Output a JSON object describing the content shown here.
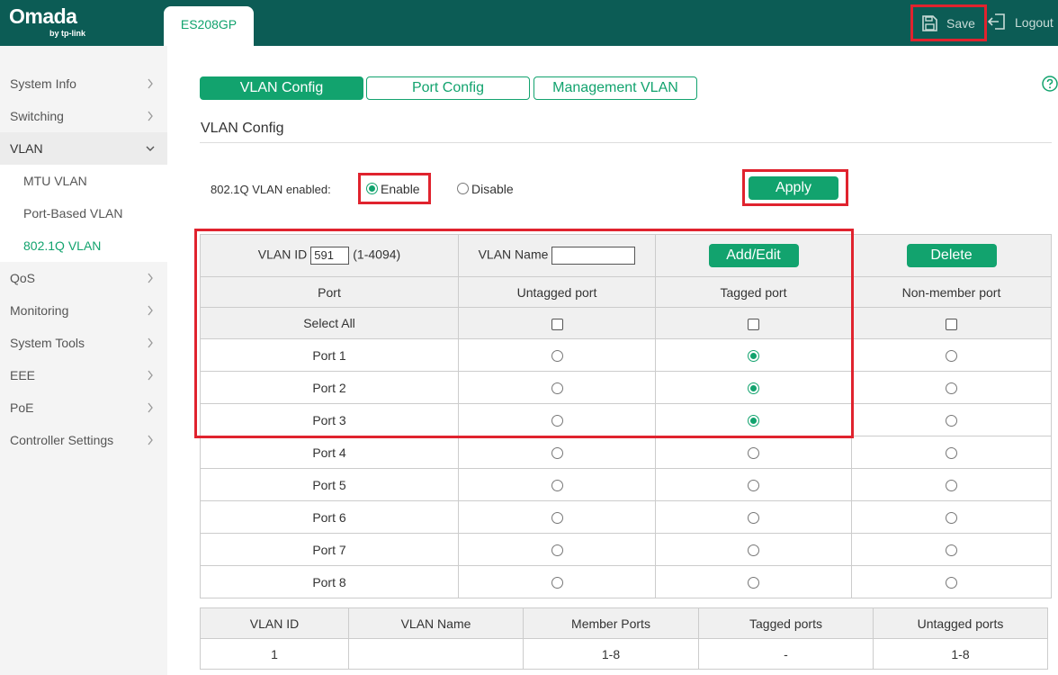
{
  "header": {
    "logo_main": "Omada",
    "logo_sub": "by tp-link",
    "device_tab": "ES208GP",
    "save_label": "Save",
    "logout_label": "Logout",
    "background_color": "#0c5c55",
    "accent_color": "#12a36e",
    "highlight_color": "#e0232e"
  },
  "sidebar": {
    "items": [
      {
        "label": "System Info"
      },
      {
        "label": "Switching"
      },
      {
        "label": "VLAN"
      },
      {
        "label": "QoS"
      },
      {
        "label": "Monitoring"
      },
      {
        "label": "System Tools"
      },
      {
        "label": "EEE"
      },
      {
        "label": "PoE"
      },
      {
        "label": "Controller Settings"
      }
    ],
    "vlan_subitems": [
      {
        "label": "MTU VLAN"
      },
      {
        "label": "Port-Based VLAN"
      },
      {
        "label": "802.1Q VLAN"
      }
    ]
  },
  "tabs": [
    {
      "label": "VLAN Config"
    },
    {
      "label": "Port Config"
    },
    {
      "label": "Management VLAN"
    }
  ],
  "section": {
    "title": "VLAN Config",
    "enabled_label": "802.1Q VLAN enabled:",
    "enable_label": "Enable",
    "disable_label": "Disable",
    "enable_selected": true,
    "apply_label": "Apply"
  },
  "config_table": {
    "vlan_id_label": "VLAN ID",
    "vlan_id_value": "591",
    "vlan_id_range": "(1-4094)",
    "vlan_name_label": "VLAN Name",
    "vlan_name_value": "",
    "add_edit_label": "Add/Edit",
    "delete_label": "Delete",
    "columns": [
      "Port",
      "Untagged port",
      "Tagged port",
      "Non-member port"
    ],
    "select_all_label": "Select All",
    "ports": [
      {
        "name": "Port 1",
        "membership": "tagged"
      },
      {
        "name": "Port 2",
        "membership": "tagged"
      },
      {
        "name": "Port 3",
        "membership": "tagged"
      },
      {
        "name": "Port 4",
        "membership": "none"
      },
      {
        "name": "Port 5",
        "membership": "none"
      },
      {
        "name": "Port 6",
        "membership": "none"
      },
      {
        "name": "Port 7",
        "membership": "none"
      },
      {
        "name": "Port 8",
        "membership": "none"
      }
    ]
  },
  "summary_table": {
    "columns": [
      "VLAN ID",
      "VLAN Name",
      "Member Ports",
      "Tagged ports",
      "Untagged ports"
    ],
    "rows": [
      {
        "vlan_id": "1",
        "vlan_name": "",
        "member_ports": "1-8",
        "tagged_ports": "-",
        "untagged_ports": "1-8"
      }
    ]
  }
}
